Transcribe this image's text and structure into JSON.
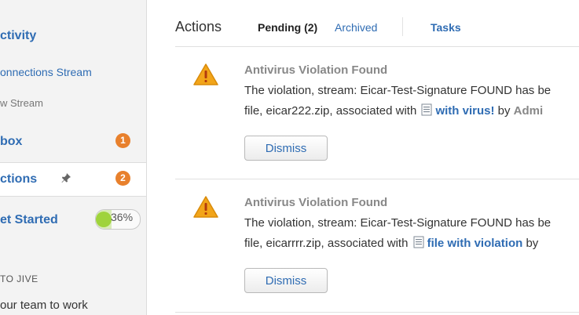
{
  "sidebar": {
    "activity": "ctivity",
    "connections_stream": "onnections Stream",
    "new_stream": "w Stream",
    "inbox": {
      "label": "box",
      "count": "1"
    },
    "actions": {
      "label": "ctions",
      "count": "2"
    },
    "get_started": {
      "label": "et Started",
      "progress": "36%",
      "progress_fraction": 0.36
    },
    "to_jive": "TO JIVE",
    "team_text": "our team to work"
  },
  "header": {
    "title": "Actions",
    "tabs": [
      {
        "label": "Pending (2)"
      },
      {
        "label": "Archived"
      },
      {
        "label": "Tasks"
      }
    ]
  },
  "cards": [
    {
      "title": "Antivirus Violation Found",
      "line1": "The violation, stream: Eicar-Test-Signature FOUND has be",
      "line2_pre": "file, eicar222.zip, associated with",
      "doc_link": "with virus!",
      "line2_post": "by",
      "author": "Admi",
      "button": "Dismiss"
    },
    {
      "title": "Antivirus Violation Found",
      "line1": "The violation, stream: Eicar-Test-Signature FOUND has be",
      "line2_pre": "file, eicarrrr.zip, associated with",
      "doc_link": "file with violation",
      "line2_post": "by",
      "button": "Dismiss"
    }
  ],
  "colors": {
    "link": "#2f6cb3",
    "badge": "#e8802c",
    "warning": "#f2a51a",
    "progress": "#9fd33c"
  },
  "icons": [
    "warning-icon",
    "document-icon",
    "pin-icon"
  ]
}
